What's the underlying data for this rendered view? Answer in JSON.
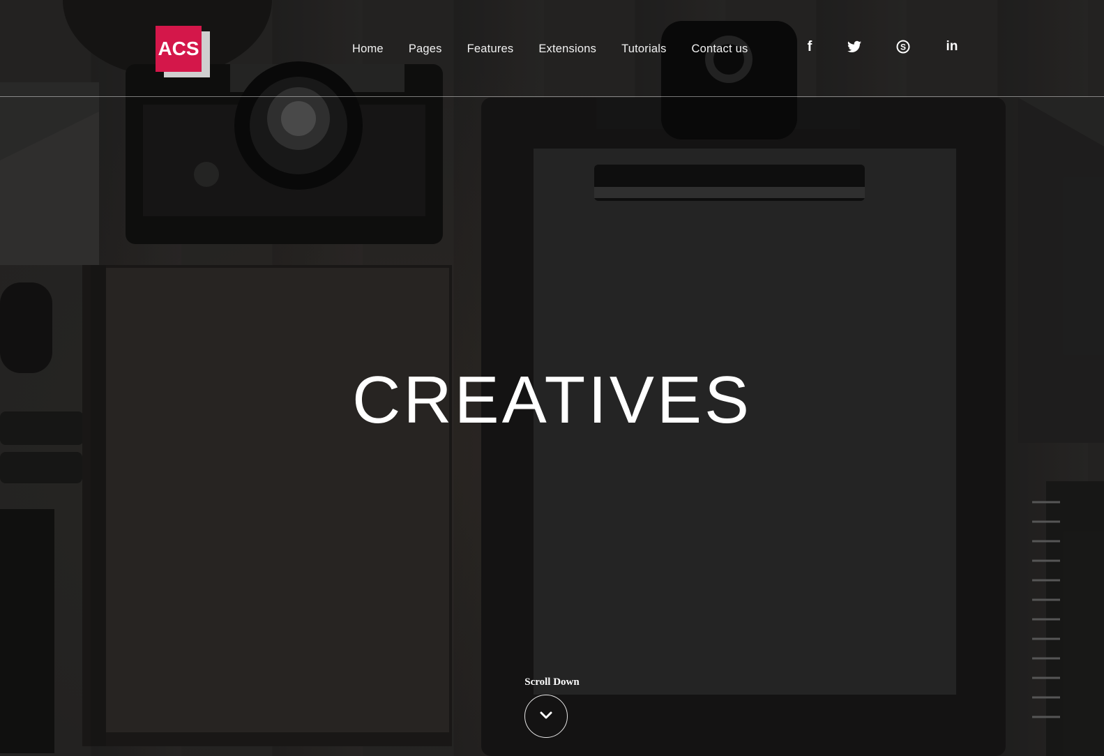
{
  "brand": {
    "logo_text": "ACS",
    "accent": "#d4174a"
  },
  "nav": {
    "items": [
      {
        "label": "Home"
      },
      {
        "label": "Pages"
      },
      {
        "label": "Features"
      },
      {
        "label": "Extensions"
      },
      {
        "label": "Tutorials"
      },
      {
        "label": "Contact us"
      }
    ]
  },
  "social": {
    "items": [
      {
        "icon": "facebook-icon",
        "glyph": "f"
      },
      {
        "icon": "twitter-icon",
        "glyph": "🐦"
      },
      {
        "icon": "skype-icon",
        "glyph": "S"
      },
      {
        "icon": "linkedin-icon",
        "glyph": "in"
      }
    ]
  },
  "hero": {
    "title": "CREATIVES",
    "scroll_label": "Scroll Down"
  }
}
